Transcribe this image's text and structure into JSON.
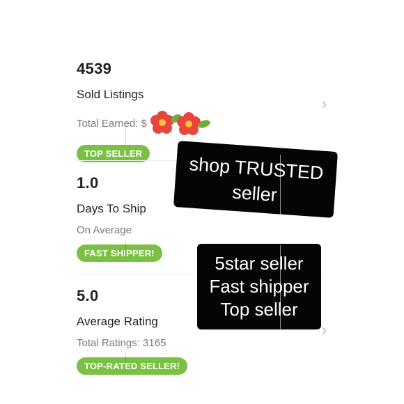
{
  "stats": [
    {
      "value": "4539",
      "label": "Sold Listings",
      "sub": "Total Earned: $",
      "badge": "TOP SELLER"
    },
    {
      "value": "1.0",
      "label": "Days To Ship",
      "sub": "On Average",
      "badge": "FAST SHIPPER!"
    },
    {
      "value": "5.0",
      "label": "Average Rating",
      "sub": "Total Ratings: 3165",
      "badge": "TOP-RATED SELLER!"
    }
  ],
  "stickers": {
    "trusted": {
      "line1": "shop TRUSTED",
      "line2": "seller"
    },
    "summary": {
      "line1": "5star seller",
      "line2": "Fast shipper",
      "line3": "Top seller"
    }
  },
  "icons": {
    "chevron": "chevron-right-icon",
    "flower": "flower-sticker-icon"
  },
  "colors": {
    "badge_green": "#7ac143",
    "sticker_black": "#050505",
    "flower_red": "#e8453c"
  }
}
